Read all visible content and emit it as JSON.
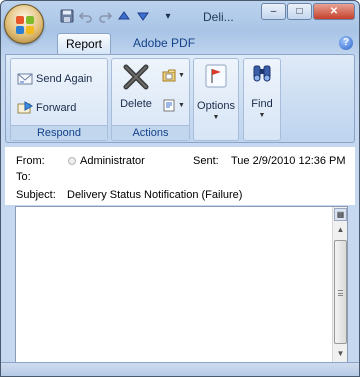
{
  "window": {
    "title": "Deli..."
  },
  "quick_access": {
    "save": "save-icon",
    "undo": "undo-icon",
    "redo": "redo-icon",
    "prev": "up-arrow-icon",
    "next": "down-arrow-icon",
    "customize": "▾"
  },
  "controls": {
    "minimize": "–",
    "maximize": "□",
    "close": "✕"
  },
  "tabs": [
    {
      "label": "Report"
    },
    {
      "label": "Adobe PDF"
    }
  ],
  "help": "?",
  "ribbon": {
    "respond": {
      "label": "Respond",
      "send_again": "Send Again",
      "forward": "Forward"
    },
    "actions": {
      "label": "Actions",
      "delete": "Delete"
    },
    "options": "Options",
    "find": "Find"
  },
  "header": {
    "from_label": "From:",
    "from_value": "Administrator",
    "sent_label": "Sent:",
    "sent_value": "Tue 2/9/2010 12:36 PM",
    "to_label": "To:",
    "subject_label": "Subject:",
    "subject_value": "Delivery Status Notification (Failure)"
  },
  "colors": {
    "accent": "#15428b",
    "ribbon": "#c7daf1",
    "frame": "#49596e"
  }
}
